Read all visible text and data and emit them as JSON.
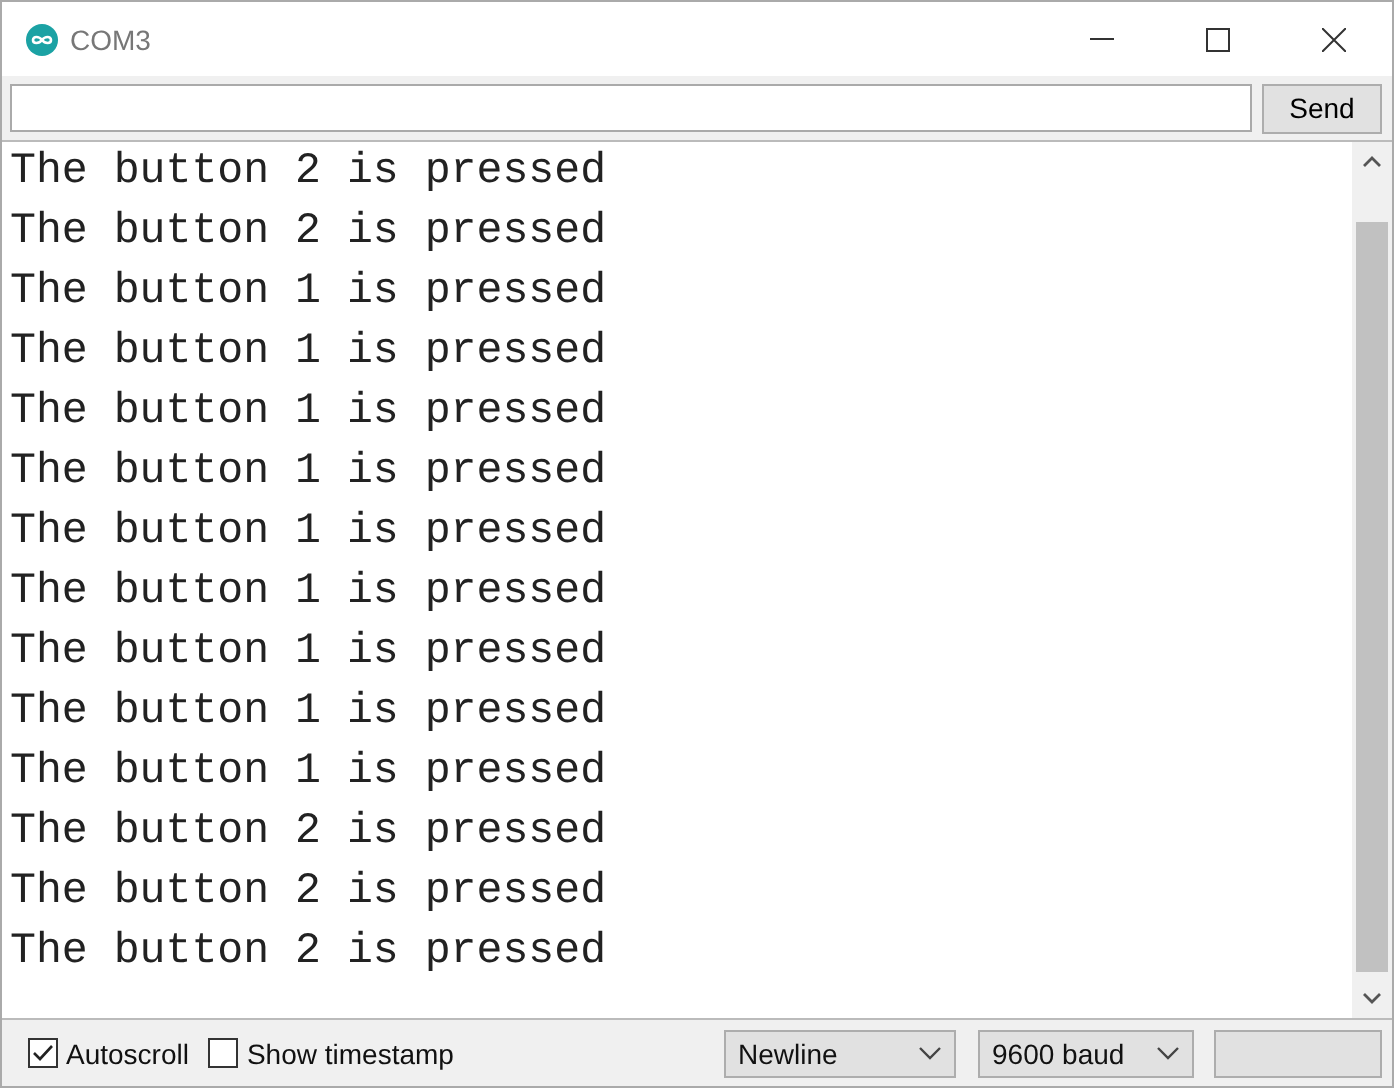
{
  "window": {
    "title": "COM3"
  },
  "send_bar": {
    "button": "Send"
  },
  "output": {
    "lines": [
      "The button 2 is pressed",
      "The button 2 is pressed",
      "The button 1 is pressed",
      "The button 1 is pressed",
      "The button 1 is pressed",
      "The button 1 is pressed",
      "The button 1 is pressed",
      "The button 1 is pressed",
      "The button 1 is pressed",
      "The button 1 is pressed",
      "The button 1 is pressed",
      "The button 2 is pressed",
      "The button 2 is pressed",
      "The button 2 is pressed"
    ]
  },
  "footer": {
    "options": [
      {
        "label": "Autoscroll",
        "checked": true
      },
      {
        "label": "Show timestamp",
        "checked": false
      }
    ],
    "line_ending": "Newline",
    "baud": "9600 baud"
  }
}
